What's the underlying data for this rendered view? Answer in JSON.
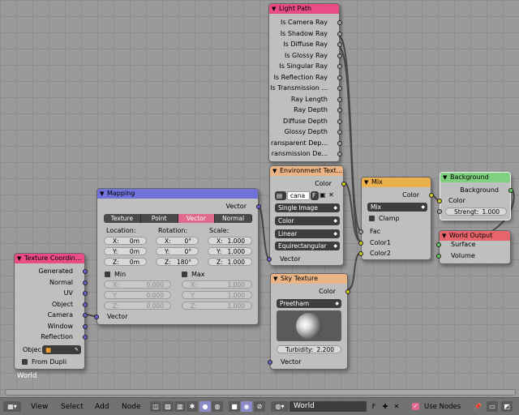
{
  "texture_coordinate": {
    "title": "Texture Coordin...",
    "outputs": [
      "Generated",
      "Normal",
      "UV",
      "Object",
      "Camera",
      "Window",
      "Reflection"
    ],
    "object_label": "Objec",
    "from_dupli": "From Dupli"
  },
  "mapping": {
    "title": "Mapping",
    "output": "Vector",
    "modes": [
      "Texture",
      "Point",
      "Vector",
      "Normal"
    ],
    "active_mode": "Vector",
    "location_label": "Location:",
    "rotation_label": "Rotation:",
    "scale_label": "Scale:",
    "location": [
      {
        "k": "X:",
        "v": "0m"
      },
      {
        "k": "Y:",
        "v": "0m"
      },
      {
        "k": "Z:",
        "v": "0m"
      }
    ],
    "rotation": [
      {
        "k": "X:",
        "v": "0°"
      },
      {
        "k": "Y:",
        "v": "0°"
      },
      {
        "k": "Z:",
        "v": "180°"
      }
    ],
    "scale": [
      {
        "k": "X:",
        "v": "1.000"
      },
      {
        "k": "Y:",
        "v": "1.000"
      },
      {
        "k": "Z:",
        "v": "1.000"
      }
    ],
    "min_label": "Min",
    "max_label": "Max",
    "min": [
      {
        "k": "X:",
        "v": "0.000"
      },
      {
        "k": "Y:",
        "v": "0.000"
      },
      {
        "k": "Z:",
        "v": "0.000"
      }
    ],
    "max": [
      {
        "k": "X:",
        "v": "1.000"
      },
      {
        "k": "Y:",
        "v": "1.000"
      },
      {
        "k": "Z:",
        "v": "1.000"
      }
    ],
    "input": "Vector"
  },
  "light_path": {
    "title": "Light Path",
    "outputs": [
      "Is Camera Ray",
      "Is Shadow Ray",
      "Is Diffuse Ray",
      "Is Glossy Ray",
      "Is Singular Ray",
      "Is Reflection Ray",
      "Is Transmission ...",
      "Ray Length",
      "Ray Depth",
      "Diffuse Depth",
      "Glossy Depth",
      "ransparent Dep...",
      "ransmission De..."
    ]
  },
  "environment_texture": {
    "title": "Environment Text...",
    "output": "Color",
    "image_name": "cana",
    "image_f": "F",
    "projection_source": "Single Image",
    "color_space": "Color",
    "interpolation": "Linear",
    "projection": "Equirectangular",
    "input": "Vector"
  },
  "sky_texture": {
    "title": "Sky Texture",
    "output": "Color",
    "model": "Preetham",
    "turbidity_label": "Turbidity:",
    "turbidity": "2.200",
    "input": "Vector"
  },
  "mix": {
    "title": "Mix",
    "output": "Color",
    "blend": "Mix",
    "clamp": "Clamp",
    "inputs": [
      "Fac",
      "Color1",
      "Color2"
    ]
  },
  "background": {
    "title": "Background",
    "output": "Background",
    "input_color": "Color",
    "strength_label": "Strengt:",
    "strength": "1.000"
  },
  "world_output": {
    "title": "World Output",
    "inputs": [
      "Surface",
      "Volume"
    ]
  },
  "canvas_label": "World",
  "header": {
    "menus": [
      "View",
      "Select",
      "Add",
      "Node"
    ],
    "world_name": "World",
    "world_f": "F",
    "use_nodes": "Use Nodes"
  },
  "colors": {
    "input_header": "#ea4c86",
    "vector_header": "#6f73d9",
    "texture_header": "#eab487",
    "mix_header": "#eab04e",
    "shader_header": "#7fd07f",
    "output_header": "#e8646c",
    "socket_color": "#c7c729",
    "socket_vector": "#6363c7",
    "socket_shader": "#63c763"
  }
}
